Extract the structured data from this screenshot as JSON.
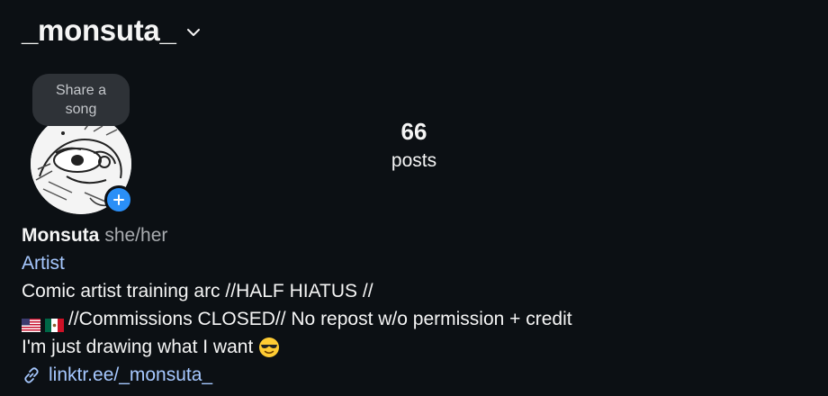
{
  "header": {
    "username": "_monsuta_",
    "icons": {
      "chevron": "chevron-down-icon"
    }
  },
  "profile": {
    "share_song": "Share a song",
    "avatar_icon": "avatar",
    "add_icon": "plus-icon",
    "badge_color": "#2a8ff7"
  },
  "stats": {
    "posts_count": "66",
    "posts_label": "posts"
  },
  "bio": {
    "name": "Monsuta",
    "pronouns": "she/her",
    "category": "Artist",
    "line1": "Comic artist training arc //HALF HIATUS //",
    "line2": "//Commissions CLOSED// No repost w/o permission + credit",
    "line2_flags": [
      "us-flag-icon",
      "mexico-flag-icon"
    ],
    "line3": "I'm just drawing what I want",
    "line3_emoji": "sunglasses-emoji-icon",
    "link": "linktr.ee/_monsuta_",
    "link_icon": "link-icon",
    "link_color": "#a6c8ff"
  }
}
